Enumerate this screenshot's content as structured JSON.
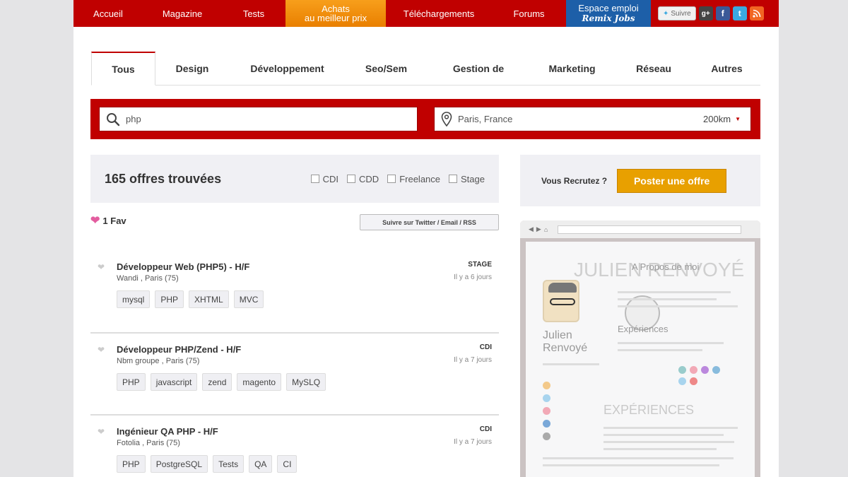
{
  "topnav": {
    "items": [
      "Accueil",
      "Magazine",
      "Tests"
    ],
    "achats_line1": "Achats",
    "achats_line2": "au meilleur prix",
    "telechargements": "Téléchargements",
    "forums": "Forums",
    "emploi_line1": "Espace emploi",
    "emploi_line2": "Remix Jobs",
    "suivre": "Suivre",
    "colors": {
      "nav": "#c00000",
      "achats": "#f08c10",
      "emploi": "#1d5fa8"
    }
  },
  "tabs": [
    "Tous",
    "Design",
    "Développement",
    "Seo/Sem",
    "Gestion de",
    "Marketing",
    "Réseau",
    "Autres"
  ],
  "search": {
    "query": "php",
    "location": "Paris, France",
    "radius": "200km"
  },
  "results": {
    "count_label": "165 offres trouvées",
    "filters": [
      "CDI",
      "CDD",
      "Freelance",
      "Stage"
    ]
  },
  "fav_label": "1 Fav",
  "follow_label": "Suivre sur Twitter / Email / RSS",
  "jobs": [
    {
      "title": "Développeur Web (PHP5) - H/F",
      "company": "Wandi , Paris (75)",
      "type": "STAGE",
      "date": "Il y a 6 jours",
      "tags": [
        "mysql",
        "PHP",
        "XHTML",
        "MVC"
      ]
    },
    {
      "title": "Développeur PHP/Zend - H/F",
      "company": "Nbm groupe , Paris (75)",
      "type": "CDI",
      "date": "Il y a 7 jours",
      "tags": [
        "PHP",
        "javascript",
        "zend",
        "magento",
        "MySLQ"
      ]
    },
    {
      "title": "Ingénieur QA PHP - H/F",
      "company": "Fotolia , Paris (75)",
      "type": "CDI",
      "date": "Il y a 7 jours",
      "tags": [
        "PHP",
        "PostgreSQL",
        "Tests",
        "QA",
        "CI"
      ]
    }
  ],
  "recruit": {
    "label": "Vous Recrutez ?",
    "button": "Poster une offre",
    "button_color": "#e8a000"
  },
  "preview": {
    "big_name": "JULIEN RENVOYÉ",
    "about": "A Propos de moi",
    "name": "Julien Renvoyé",
    "exp1": "Expériences",
    "exp2": "EXPÉRIENCES"
  }
}
